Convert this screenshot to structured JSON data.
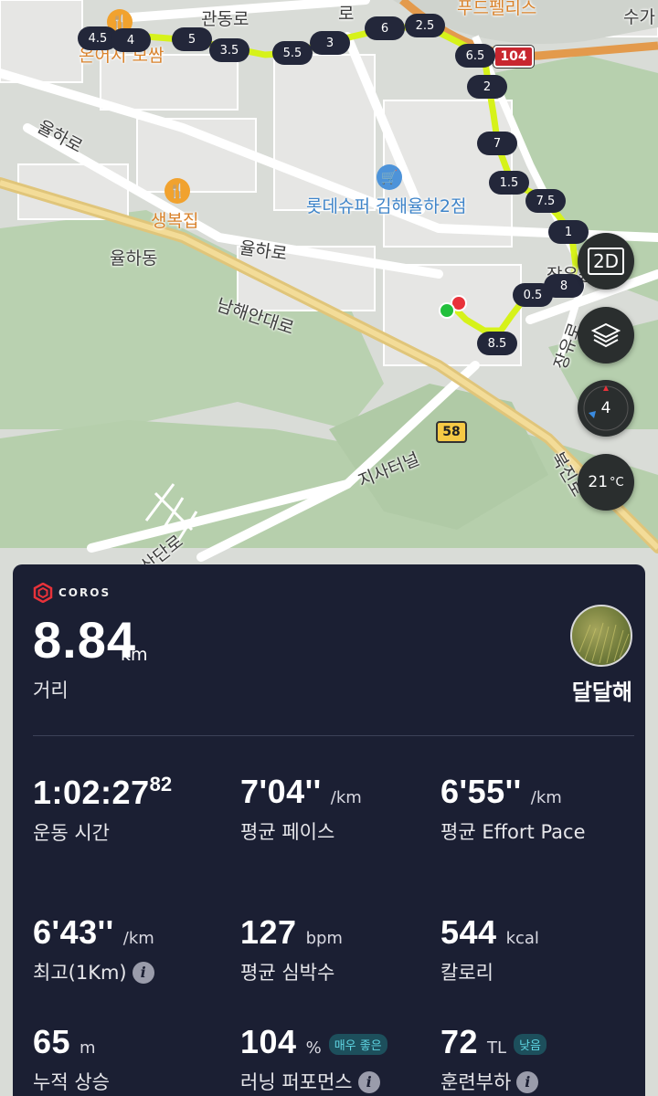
{
  "map": {
    "labels": {
      "gwandongro": "관동로",
      "ro_top": "로",
      "food_palace": "푸드펠리스",
      "suga": "수가",
      "restaurant_top": "온어시 모쌈",
      "yulharo_left": "율하로",
      "saengbokjip": "생복집",
      "lotte_super": "롯데슈퍼 김해율하2점",
      "yulhadong": "율하동",
      "yulharo_mid": "율하로",
      "namhae_expressway": "남해안대로",
      "jangyu": "장유동",
      "jangyuro": "장유로",
      "jisa_tunnel": "지사터널",
      "bukjangyu": "북진로",
      "sanrodan": "산단로"
    },
    "route_shields": {
      "r104": "104",
      "r58": "58"
    },
    "km_markers": [
      "4.5",
      "4",
      "5",
      "3.5",
      "5.5",
      "3",
      "6",
      "2.5",
      "6.5",
      "2",
      "7",
      "1.5",
      "7.5",
      "1",
      "8",
      "0.5",
      "8.5"
    ],
    "controls": {
      "view_mode": "2D",
      "compass_value": "4",
      "temperature": "21",
      "temperature_unit": "°C"
    },
    "colors": {
      "route": "#d6f21a",
      "start": "#22c03c",
      "end": "#e8323a"
    }
  },
  "card": {
    "brand": "COROS",
    "distance": {
      "value": "8.84",
      "unit": "km",
      "label": "거리"
    },
    "user": {
      "name": "달달해"
    },
    "stats": {
      "duration": {
        "value": "1:02:27",
        "sup": "82",
        "label": "운동 시간"
      },
      "avg_pace": {
        "value": "7'04''",
        "unit": "/km",
        "label": "평균 페이스"
      },
      "avg_effort_pace": {
        "value": "6'55''",
        "unit": "/km",
        "label": "평균 Effort Pace"
      },
      "best_pace": {
        "value": "6'43''",
        "unit": "/km",
        "label": "최고(1Km)"
      },
      "avg_hr": {
        "value": "127",
        "unit": "bpm",
        "label": "평균 심박수"
      },
      "calories": {
        "value": "544",
        "unit": "kcal",
        "label": "칼로리"
      },
      "elevation_gain": {
        "value": "65",
        "unit": "m",
        "label": "누적 상승"
      },
      "running_performance": {
        "value": "104",
        "unit": "%",
        "badge": "매우 좋은",
        "label": "러닝 퍼포먼스"
      },
      "training_load": {
        "value": "72",
        "unit": "TL",
        "badge": "낮음",
        "label": "훈련부하"
      }
    }
  }
}
